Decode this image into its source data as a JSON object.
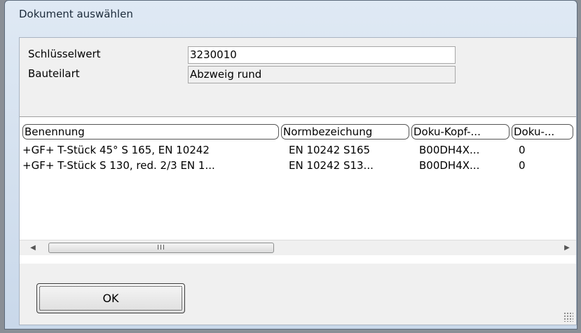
{
  "window": {
    "title": "Dokument auswählen"
  },
  "form": {
    "key_label": "Schlüsselwert",
    "key_value": "3230010",
    "type_label": "Bauteilart",
    "type_value": "Abzweig rund"
  },
  "table": {
    "columns": [
      "Benennung",
      "Normbezeichung",
      "Doku-Kopf-...",
      "Doku-..."
    ],
    "rows": [
      [
        "+GF+ T-Stück 45° S 165, EN 10242",
        "EN 10242 S165",
        "B00DH4X...",
        "0"
      ],
      [
        "+GF+ T-Stück S 130, red. 2/3 EN 1...",
        "EN 10242 S13...",
        "B00DH4X...",
        "0"
      ]
    ]
  },
  "scrollbar": {
    "thumb_grip": "III",
    "left_arrow": "◀",
    "right_arrow": "▶"
  },
  "buttons": {
    "ok": "OK"
  }
}
